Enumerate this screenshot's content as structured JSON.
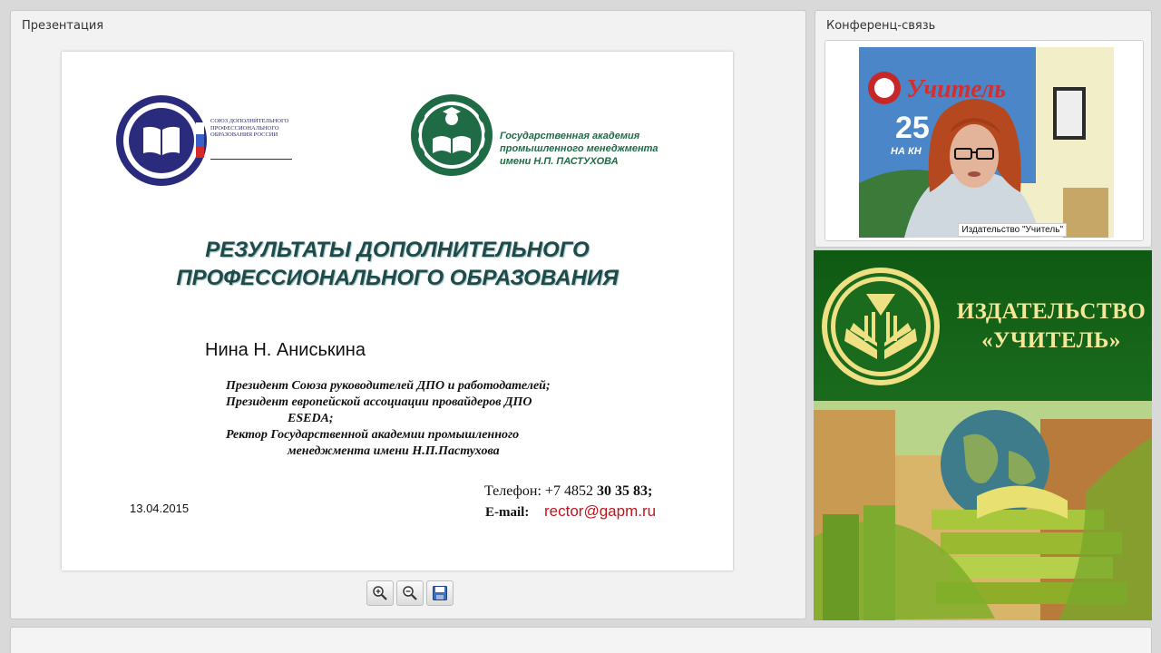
{
  "presentation_panel": {
    "title": "Презентация",
    "slide": {
      "union_logo_text": "СОЮЗ ДОПОЛНИТЕЛЬНОГО ПРОФЕССИОНАЛЬНОГО ОБРАЗОВАНИЯ РОССИИ",
      "academy_name": "Государственная академия промышленного менеджмента имени Н.П. ПАСТУХОВА",
      "title_line1": "РЕЗУЛЬТАТЫ ДОПОЛНИТЕЛЬНОГО",
      "title_line2": "ПРОФЕССИОНАЛЬНОГО ОБРАЗОВАНИЯ",
      "author": "Нина Н. Аниськина",
      "role1": "Президент Союза руководителей ДПО и работодателей;",
      "role2": "Президент европейской ассоциации провайдеров ДПО",
      "role2b": "ESEDA;",
      "role3": "Ректор Государственной академии промышленного",
      "role3b": "менеджмента имени Н.П.Пастухова",
      "date": "13.04.2015",
      "phone_label": "Телефон: +7 4852 ",
      "phone_number": "30 35 83;",
      "email_label": "E-mail:",
      "email": "rector@gapm.ru"
    },
    "toolbar": {
      "zoom_in": "zoom-in-icon",
      "zoom_out": "zoom-out-icon",
      "save": "save-icon"
    }
  },
  "conference_panel": {
    "title": "Конференц-связь",
    "video_caption": "Издательство \"Учитель\"",
    "poster_text": "Учитель",
    "poster_number": "25",
    "poster_subtext": "НА КН"
  },
  "publisher_banner": {
    "name_line1": "ИЗДАТЕЛЬСТВО",
    "name_line2": "«УЧИТЕЛЬ»"
  },
  "colors": {
    "slide_title": "#1f4a4a",
    "email": "#c0161e",
    "academy_green": "#1f6b46",
    "banner_green": "#1a6b1e",
    "banner_text": "#f4e79a"
  }
}
